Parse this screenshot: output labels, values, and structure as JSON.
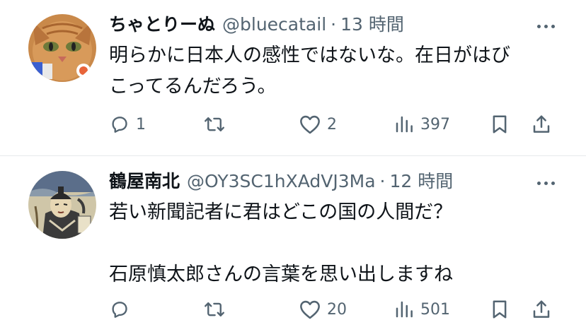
{
  "tweets": [
    {
      "name": "ちゃとりーぬ",
      "handle": "@bluecatail",
      "separator": "·",
      "time": "13 時間",
      "lines": [
        "明らかに日本人の感性ではないな。在日がはび",
        "こってるんだろう。"
      ],
      "replies": "1",
      "retweets": "",
      "likes": "2",
      "views": "397",
      "avatar": "orange-cat-avatar"
    },
    {
      "name": "鶴屋南北",
      "handle": "@OY3SC1hXAdVJ3Ma",
      "separator": "·",
      "time": "12 時間",
      "lines": [
        "若い新聞記者に君はどこの国の人間だ？",
        "",
        "石原慎太郎さんの言葉を思い出しますね"
      ],
      "replies": "",
      "retweets": "",
      "likes": "20",
      "views": "501",
      "avatar": "ukiyoe-portrait-avatar"
    }
  ],
  "colors": {
    "text": "#0f1419",
    "secondary": "#536471",
    "divider": "#e6e9ec"
  }
}
